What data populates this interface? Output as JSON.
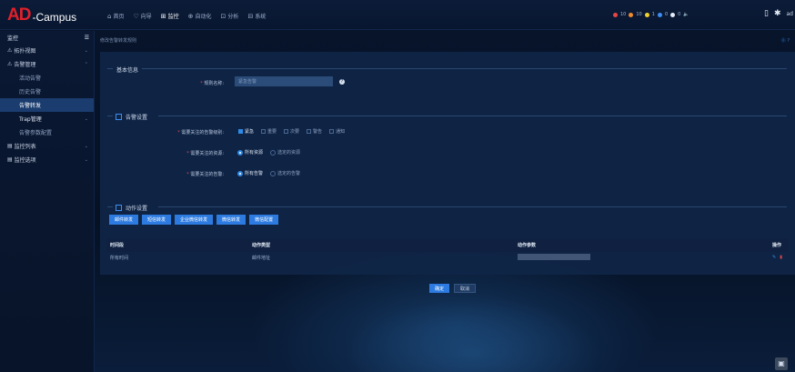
{
  "app": {
    "logo_ad": "AD",
    "logo_campus": "-Campus"
  },
  "nav": [
    {
      "icon": "⌂",
      "label": "首页",
      "active": false
    },
    {
      "icon": "♡",
      "label": "向导",
      "active": false
    },
    {
      "icon": "⊞",
      "label": "监控",
      "active": true
    },
    {
      "icon": "⊕",
      "label": "自动化",
      "active": false
    },
    {
      "icon": "⊡",
      "label": "分析",
      "active": false
    },
    {
      "icon": "⊟",
      "label": "系统",
      "active": false
    }
  ],
  "status": {
    "c1": "10",
    "c2": "10",
    "c3": "1",
    "c4": "0",
    "c5": "0"
  },
  "user": "ad",
  "sidebar": {
    "title": "监控",
    "items": [
      {
        "label": "拓扑视图",
        "type": "top",
        "chev": "⌄"
      },
      {
        "label": "告警管理",
        "type": "top",
        "chev": "⌃"
      },
      {
        "label": "活动告警",
        "type": "sub"
      },
      {
        "label": "历史告警",
        "type": "sub"
      },
      {
        "label": "告警转发",
        "type": "sub"
      },
      {
        "label": "Trap管理",
        "type": "sub",
        "chev": "⌄"
      },
      {
        "label": "告警参数配置",
        "type": "sub"
      },
      {
        "label": "监控列表",
        "type": "top",
        "chev": "⌄"
      },
      {
        "label": "监控选项",
        "type": "top",
        "chev": "⌄"
      }
    ]
  },
  "breadcrumb": "修改告警转发规则",
  "help_text": "⓪ ?",
  "basic": {
    "section": "基本信息",
    "rule_name_label": "规则名称:",
    "rule_name_value": "紧急告警"
  },
  "alarm": {
    "section": "告警设置",
    "level_label": "需要关注的告警级别:",
    "levels": [
      {
        "label": "紧急",
        "checked": true
      },
      {
        "label": "重要",
        "checked": false
      },
      {
        "label": "次要",
        "checked": false
      },
      {
        "label": "警告",
        "checked": false
      },
      {
        "label": "通知",
        "checked": false
      }
    ],
    "resource_label": "需要关注的资源:",
    "resource_opts": [
      {
        "label": "所有资源",
        "checked": true
      },
      {
        "label": "选定的资源",
        "checked": false
      }
    ],
    "alarm_label": "需要关注的告警:",
    "alarm_opts": [
      {
        "label": "所有告警",
        "checked": true
      },
      {
        "label": "选定的告警",
        "checked": false
      }
    ]
  },
  "action": {
    "section": "动作设置",
    "buttons": [
      "邮件转发",
      "短信转发",
      "企业微信转发",
      "微信转发",
      "微信配置"
    ]
  },
  "table": {
    "headers": [
      "时间段",
      "动作类型",
      "动作参数",
      "操作"
    ],
    "rows": [
      {
        "time": "所有时间",
        "type": "邮件地址",
        "param": ""
      }
    ]
  },
  "footer": {
    "ok": "确定",
    "cancel": "取消"
  }
}
